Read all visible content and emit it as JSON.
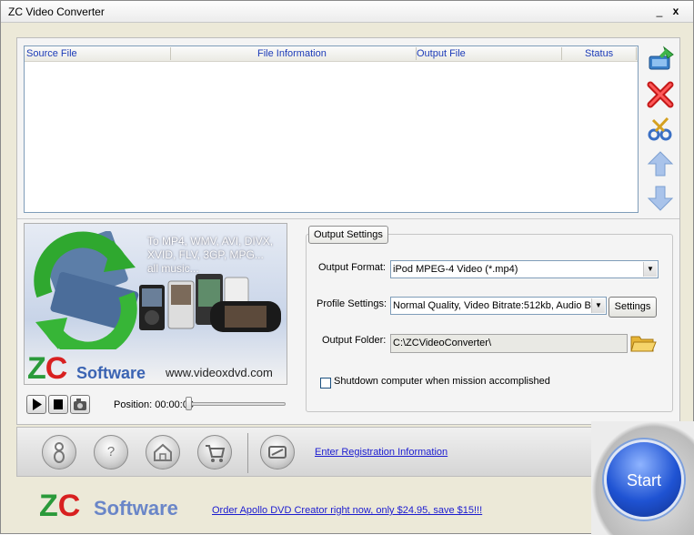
{
  "window": {
    "title": "ZC Video Converter",
    "minimize": "_",
    "close": "x"
  },
  "filelist": {
    "columns": [
      "Source File",
      "File Information",
      "Output File",
      "Status"
    ]
  },
  "side_buttons": [
    {
      "icon": "add-file-icon"
    },
    {
      "icon": "remove-icon"
    },
    {
      "icon": "clip-icon"
    },
    {
      "icon": "arrow-up-icon"
    },
    {
      "icon": "arrow-down-icon"
    }
  ],
  "banner": {
    "line1": "To MP4, WMV, AVI, DIVX,",
    "line2": "XVID, FLV, 3GP, MPG...",
    "line3": "all music...",
    "logo_z": "Z",
    "logo_c": "C",
    "logo_software": "Software",
    "url": "www.videoxdvd.com"
  },
  "player": {
    "position_label": "Position: 00:00:00",
    "progress": 0
  },
  "output_settings": {
    "tab_label": "Output Settings",
    "format_label": "Output Format:",
    "format_value": "iPod MPEG-4 Video (*.mp4)",
    "profile_label": "Profile Settings:",
    "profile_value": "Normal Quality, Video Bitrate:512kb, Audio B",
    "settings_button": "Settings",
    "folder_label": "Output Folder:",
    "folder_value": "C:\\ZCVideoConverter\\",
    "shutdown_label": "Shutdown computer when mission accomplished",
    "shutdown_checked": false
  },
  "bottom_bar": {
    "buttons": [
      "help-person-icon",
      "question-icon",
      "home-icon",
      "cart-icon",
      "register-icon"
    ],
    "registration_link": "Enter Registration Information"
  },
  "footer": {
    "logo_z": "Z",
    "logo_c": "C",
    "logo_software": "Software",
    "order_link": "Order Apollo DVD Creator right now, only $24.95, save $15!!!"
  },
  "start_button": "Start"
}
